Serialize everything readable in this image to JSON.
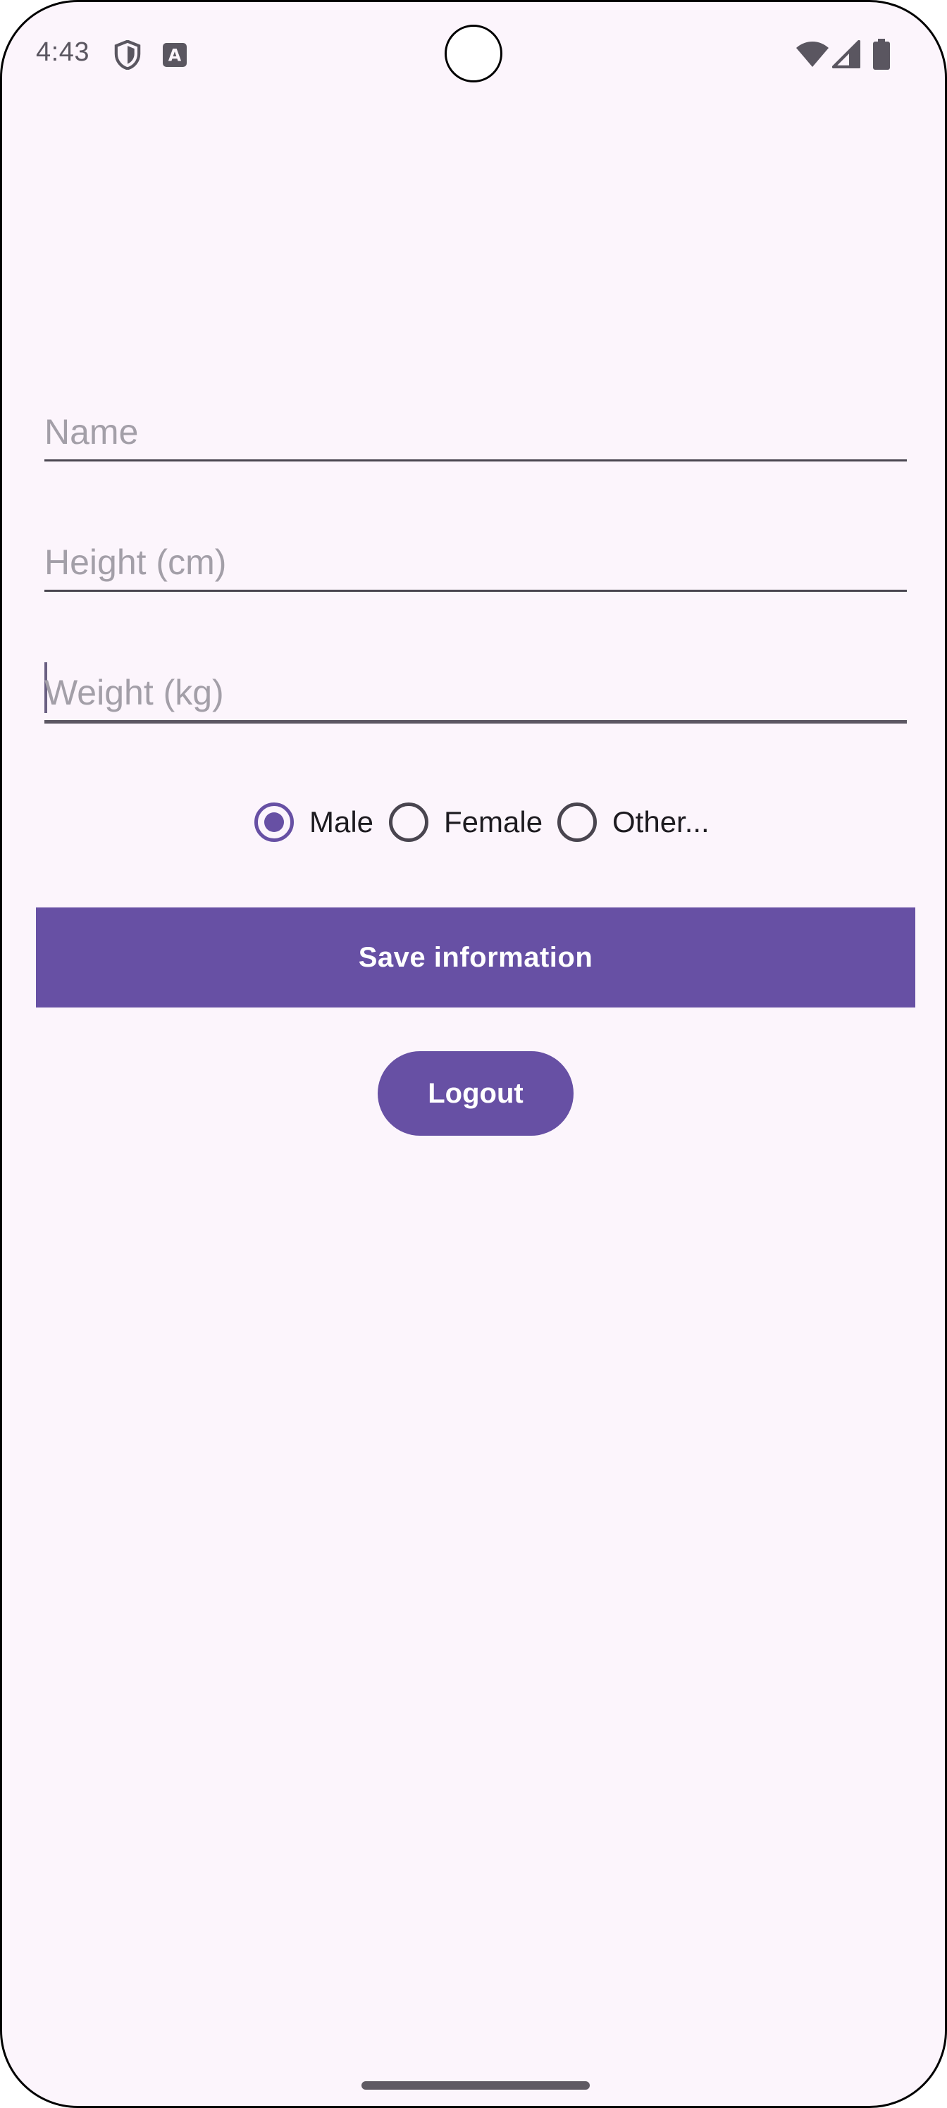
{
  "status_bar": {
    "time": "4:43",
    "icons": [
      "shield-icon",
      "accessibility-a-icon",
      "wifi-icon",
      "signal-icon",
      "battery-icon"
    ]
  },
  "form": {
    "name_placeholder": "Name",
    "height_placeholder": "Height (cm)",
    "weight_placeholder": "Weight (kg)",
    "name_value": "",
    "height_value": "",
    "weight_value": ""
  },
  "gender": {
    "options": [
      "Male",
      "Female",
      "Other..."
    ],
    "selected": "Male"
  },
  "buttons": {
    "save_label": "Save information",
    "logout_label": "Logout"
  },
  "colors": {
    "background": "#fcf5fc",
    "primary": "#6750a4",
    "on_primary": "#ffffff",
    "placeholder": "#a39fa8",
    "outline": "#49454f"
  }
}
